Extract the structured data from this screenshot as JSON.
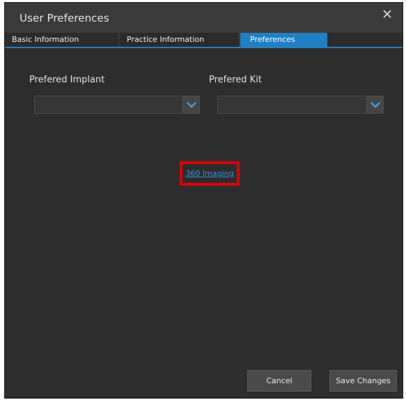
{
  "window": {
    "title": "User Preferences",
    "close_icon": "close-icon"
  },
  "tabs": [
    {
      "label": "Basic Information",
      "active": false
    },
    {
      "label": "Practice Information",
      "active": false
    },
    {
      "label": "Preferences",
      "active": true
    }
  ],
  "preferences": {
    "implant": {
      "label": "Prefered Implant",
      "value": ""
    },
    "kit": {
      "label": "Prefered Kit",
      "value": ""
    },
    "imaging_link": "360 Imaging",
    "dropdown_icon": "chevron-down-icon"
  },
  "footer": {
    "cancel_label": "Cancel",
    "save_label": "Save Changes"
  },
  "colors": {
    "background": "#2d2d2d",
    "accent": "#1f80c4",
    "link": "#2f95e0",
    "highlight": "#e00000"
  }
}
